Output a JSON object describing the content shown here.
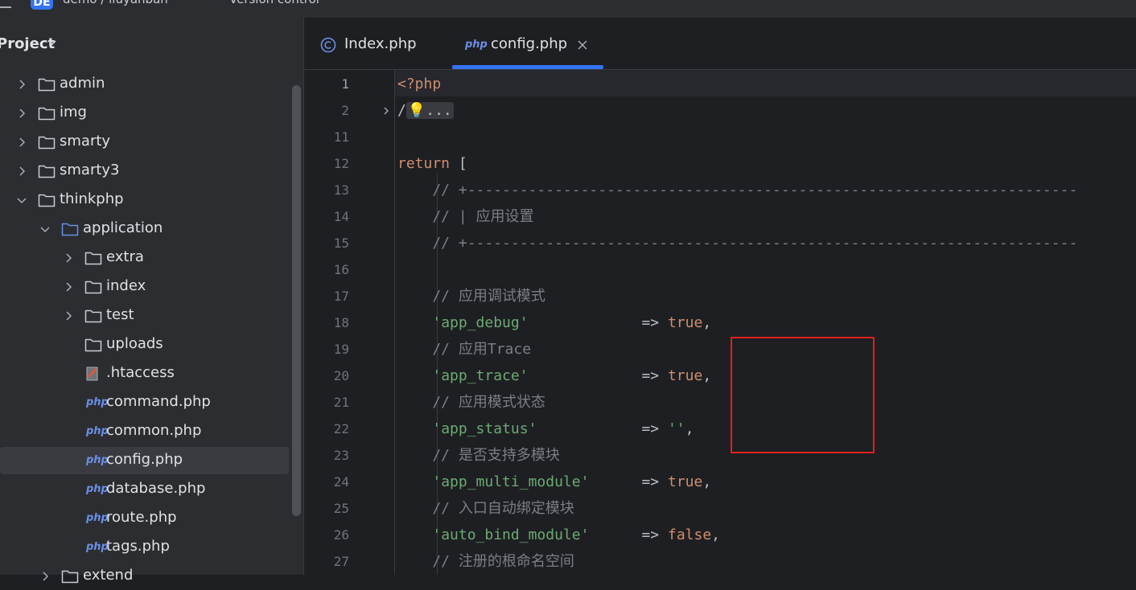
{
  "titlebar": {
    "project_badge": "DE",
    "project_name": "demo / liuyanban",
    "vcs_label": "Version control"
  },
  "sidebar": {
    "title": "Project",
    "tree": [
      {
        "label": "admin",
        "type": "folder",
        "depth": 0,
        "expanded": false
      },
      {
        "label": "img",
        "type": "folder",
        "depth": 0,
        "expanded": false
      },
      {
        "label": "smarty",
        "type": "folder",
        "depth": 0,
        "expanded": false
      },
      {
        "label": "smarty3",
        "type": "folder",
        "depth": 0,
        "expanded": false
      },
      {
        "label": "thinkphp",
        "type": "folder",
        "depth": 0,
        "expanded": true
      },
      {
        "label": "application",
        "type": "folder-blue",
        "depth": 1,
        "expanded": true
      },
      {
        "label": "extra",
        "type": "folder",
        "depth": 2,
        "expanded": false
      },
      {
        "label": "index",
        "type": "folder",
        "depth": 2,
        "expanded": false
      },
      {
        "label": "test",
        "type": "folder",
        "depth": 2,
        "expanded": false
      },
      {
        "label": "uploads",
        "type": "folder",
        "depth": 2,
        "leaf": true
      },
      {
        "label": ".htaccess",
        "type": "htaccess",
        "depth": 2,
        "leaf": true
      },
      {
        "label": "command.php",
        "type": "php",
        "depth": 2,
        "leaf": true
      },
      {
        "label": "common.php",
        "type": "php",
        "depth": 2,
        "leaf": true
      },
      {
        "label": "config.php",
        "type": "php",
        "depth": 2,
        "leaf": true,
        "selected": true
      },
      {
        "label": "database.php",
        "type": "php",
        "depth": 2,
        "leaf": true
      },
      {
        "label": "route.php",
        "type": "php",
        "depth": 2,
        "leaf": true
      },
      {
        "label": "tags.php",
        "type": "php",
        "depth": 2,
        "leaf": true
      },
      {
        "label": "extend",
        "type": "folder",
        "depth": 1,
        "expanded": false
      }
    ]
  },
  "tabs": [
    {
      "label": "Index.php",
      "icon": "class-icon",
      "active": false
    },
    {
      "label": "config.php",
      "icon": "php-icon",
      "active": true,
      "php_badge": "php"
    }
  ],
  "php_badge": "php",
  "code": {
    "lines": [
      {
        "num": "1",
        "tokens": [
          {
            "t": "<?php",
            "c": "kw"
          }
        ]
      },
      {
        "num": "2",
        "tokens": [
          {
            "t": "/",
            "c": "op"
          },
          {
            "t": "💡...",
            "c": "fold"
          }
        ],
        "folded": true
      },
      {
        "num": "11",
        "tokens": []
      },
      {
        "num": "12",
        "tokens": [
          {
            "t": "return",
            "c": "kw"
          },
          {
            "t": " [",
            "c": "op"
          }
        ]
      },
      {
        "num": "13",
        "tokens": [
          {
            "t": "    // +----------------------------------------------------------------------",
            "c": "cmt"
          }
        ]
      },
      {
        "num": "14",
        "tokens": [
          {
            "t": "    // | 应用设置",
            "c": "cmt"
          }
        ]
      },
      {
        "num": "15",
        "tokens": [
          {
            "t": "    // +----------------------------------------------------------------------",
            "c": "cmt"
          }
        ]
      },
      {
        "num": "16",
        "tokens": []
      },
      {
        "num": "17",
        "tokens": [
          {
            "t": "    // 应用调试模式",
            "c": "cmt"
          }
        ]
      },
      {
        "num": "18",
        "tokens": [
          {
            "t": "    ",
            "c": "op"
          },
          {
            "t": "'app_debug'",
            "c": "str"
          },
          {
            "t": "             => ",
            "c": "op"
          },
          {
            "t": "true",
            "c": "kw"
          },
          {
            "t": ",",
            "c": "op"
          }
        ]
      },
      {
        "num": "19",
        "tokens": [
          {
            "t": "    // 应用Trace",
            "c": "cmt"
          }
        ]
      },
      {
        "num": "20",
        "tokens": [
          {
            "t": "    ",
            "c": "op"
          },
          {
            "t": "'app_trace'",
            "c": "str"
          },
          {
            "t": "             => ",
            "c": "op"
          },
          {
            "t": "true",
            "c": "kw"
          },
          {
            "t": ",",
            "c": "op"
          }
        ]
      },
      {
        "num": "21",
        "tokens": [
          {
            "t": "    // 应用模式状态",
            "c": "cmt"
          }
        ]
      },
      {
        "num": "22",
        "tokens": [
          {
            "t": "    ",
            "c": "op"
          },
          {
            "t": "'app_status'",
            "c": "str"
          },
          {
            "t": "            => ",
            "c": "op"
          },
          {
            "t": "''",
            "c": "str"
          },
          {
            "t": ",",
            "c": "op"
          }
        ]
      },
      {
        "num": "23",
        "tokens": [
          {
            "t": "    // 是否支持多模块",
            "c": "cmt"
          }
        ]
      },
      {
        "num": "24",
        "tokens": [
          {
            "t": "    ",
            "c": "op"
          },
          {
            "t": "'app_multi_module'",
            "c": "str"
          },
          {
            "t": "      => ",
            "c": "op"
          },
          {
            "t": "true",
            "c": "kw"
          },
          {
            "t": ",",
            "c": "op"
          }
        ]
      },
      {
        "num": "25",
        "tokens": [
          {
            "t": "    // 入口自动绑定模块",
            "c": "cmt"
          }
        ]
      },
      {
        "num": "26",
        "tokens": [
          {
            "t": "    ",
            "c": "op"
          },
          {
            "t": "'auto_bind_module'",
            "c": "str"
          },
          {
            "t": "      => ",
            "c": "op"
          },
          {
            "t": "false",
            "c": "kw"
          },
          {
            "t": ",",
            "c": "op"
          }
        ]
      },
      {
        "num": "27",
        "tokens": [
          {
            "t": "    // 注册的根命名空间",
            "c": "cmt"
          }
        ]
      }
    ]
  },
  "colors": {
    "accent": "#3574f0",
    "highlight_box": "#e0201f",
    "keyword": "#cf8e6d",
    "string": "#6aab73",
    "comment": "#7a7e85"
  }
}
